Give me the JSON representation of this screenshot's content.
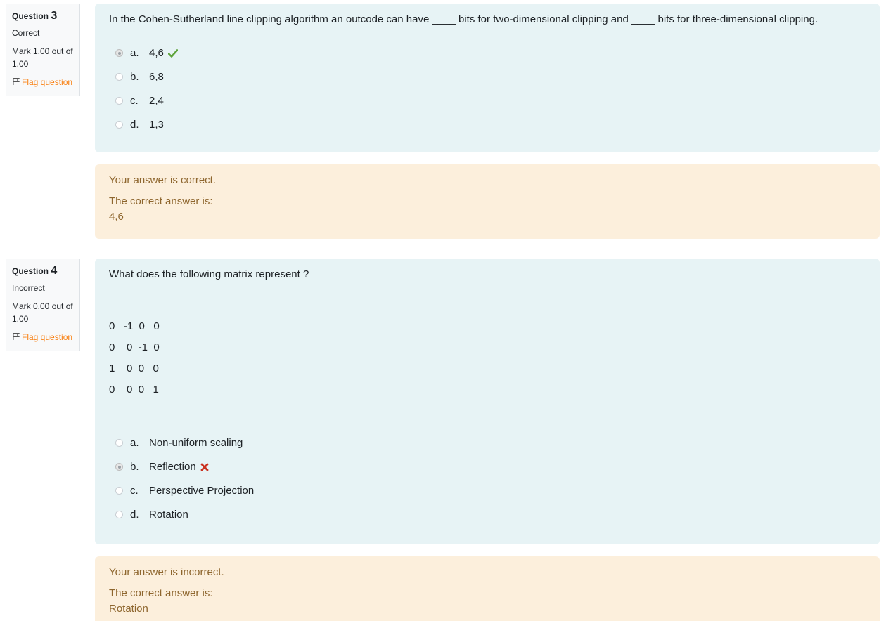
{
  "questions": [
    {
      "number_label": "Question",
      "number": "3",
      "state": "Correct",
      "grade": "Mark 1.00 out of 1.00",
      "flag_label": "Flag question",
      "text": "In the Cohen-Sutherland line clipping algorithm an outcode can have ____ bits for two-dimensional clipping and ____ bits for three-dimensional clipping.",
      "answers": [
        {
          "letter": "a.",
          "text": "4,6",
          "checked": true,
          "feedback": "correct"
        },
        {
          "letter": "b.",
          "text": "6,8",
          "checked": false,
          "feedback": ""
        },
        {
          "letter": "c.",
          "text": "2,4",
          "checked": false,
          "feedback": ""
        },
        {
          "letter": "d.",
          "text": "1,3",
          "checked": false,
          "feedback": ""
        }
      ],
      "outcome": {
        "result": "Your answer is correct.",
        "right_answer_label": "The correct answer is:",
        "right_answer": "4,6"
      }
    },
    {
      "number_label": "Question",
      "number": "4",
      "state": "Incorrect",
      "grade": "Mark 0.00 out of 1.00",
      "flag_label": "Flag question",
      "text": "What does the following matrix represent ?",
      "matrix": [
        "0   -1  0   0",
        "0    0  -1  0",
        "1    0  0   0",
        "0    0  0   1"
      ],
      "answers": [
        {
          "letter": "a.",
          "text": "Non-uniform scaling",
          "checked": false,
          "feedback": ""
        },
        {
          "letter": "b.",
          "text": "Reflection",
          "checked": true,
          "feedback": "incorrect"
        },
        {
          "letter": "c.",
          "text": "Perspective Projection",
          "checked": false,
          "feedback": ""
        },
        {
          "letter": "d.",
          "text": "Rotation",
          "checked": false,
          "feedback": ""
        }
      ],
      "outcome": {
        "result": "Your answer is incorrect.",
        "right_answer_label": "The correct answer is:",
        "right_answer": "Rotation"
      }
    }
  ],
  "colors": {
    "correct": "#5ea33b",
    "incorrect": "#ca3120",
    "flag": "#f98012"
  },
  "icons": {
    "correct": "check-icon",
    "incorrect": "cross-icon",
    "flag": "flag-icon"
  }
}
